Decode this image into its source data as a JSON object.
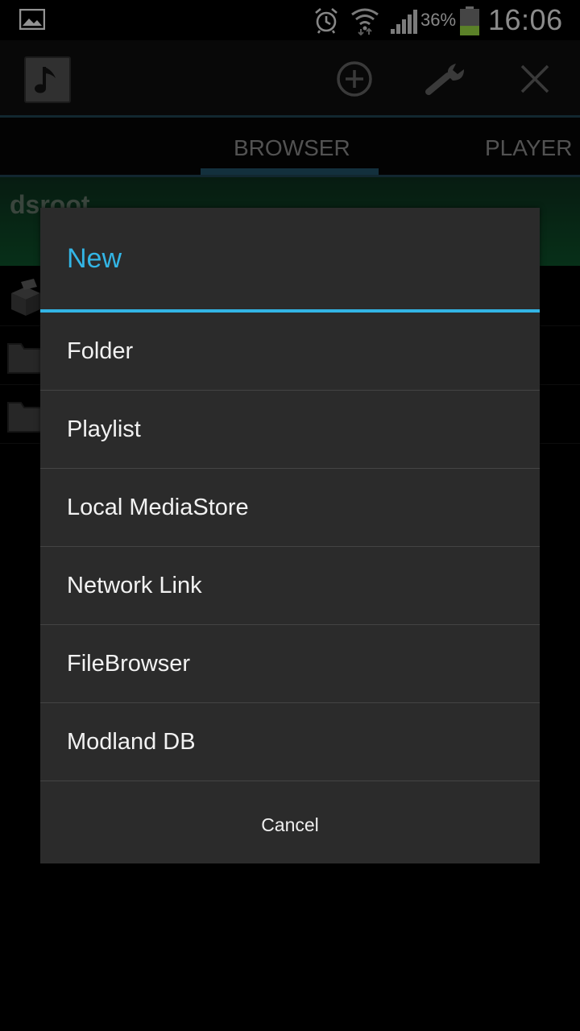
{
  "status_bar": {
    "battery_percent": "36%",
    "battery_level": 0.36,
    "time": "16:06",
    "icons": [
      "gallery-icon",
      "alarm-icon",
      "wifi-icon",
      "signal-icon",
      "battery-icon"
    ]
  },
  "action_bar": {
    "icons": [
      "app-music-note-icon",
      "add-circle-icon",
      "wrench-icon",
      "close-icon"
    ]
  },
  "tabs": [
    {
      "label": "BROWSER",
      "selected": true
    },
    {
      "label": "PLAYER",
      "selected": false
    }
  ],
  "path": {
    "label": "dsroot"
  },
  "dialog": {
    "title": "New",
    "items": [
      {
        "label": "Folder"
      },
      {
        "label": "Playlist"
      },
      {
        "label": "Local MediaStore"
      },
      {
        "label": "Network Link"
      },
      {
        "label": "FileBrowser"
      },
      {
        "label": "Modland DB"
      }
    ],
    "cancel_label": "Cancel"
  },
  "colors": {
    "accent": "#33b5e5",
    "dialog_bg": "#2b2b2b",
    "path_bar": "#0c4a26",
    "battery_fill": "#8cc63e"
  }
}
